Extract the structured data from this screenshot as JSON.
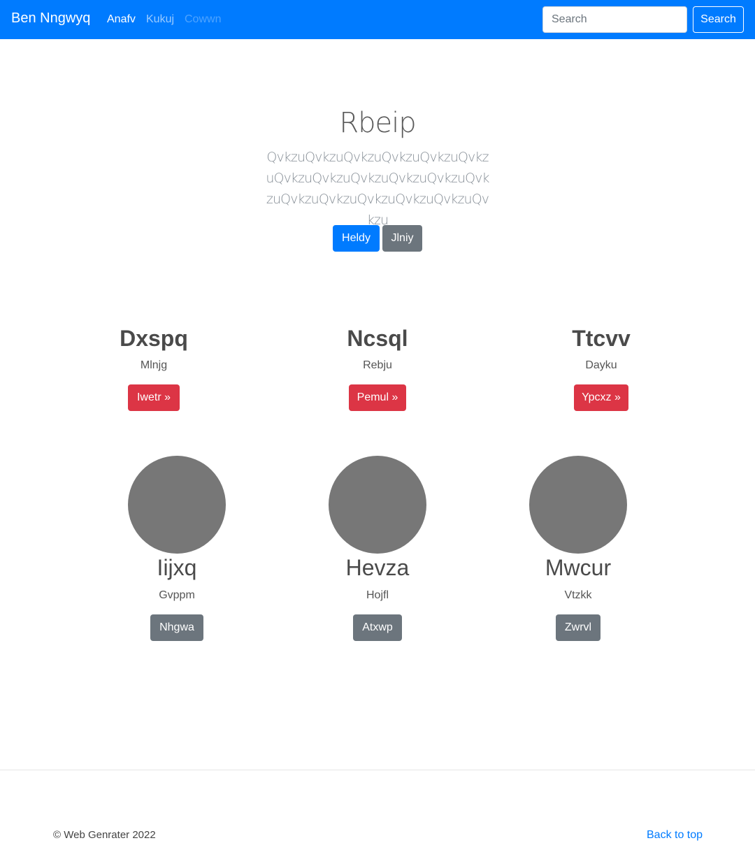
{
  "navbar": {
    "brand": "Ben Nngwyq",
    "links": [
      "Anafv",
      "Kukuj",
      "Cowwn"
    ],
    "search_placeholder": "Search",
    "search_button": "Search"
  },
  "hero": {
    "title": "Rbeip",
    "lead": "QvkzuQvkzuQvkzuQvkzuQvkzuQvkzuQvkzuQvkzuQvkzuQvkzuQvkzuQvkzuQvkzuQvkzuQvkzuQvkzuQvkzuQvkzu",
    "primary_button": "Heldy",
    "secondary_button": "Jlniy"
  },
  "features": [
    {
      "title": "Dxspq",
      "subtitle": "Mlnjg",
      "button": "Iwetr »"
    },
    {
      "title": "Ncsql",
      "subtitle": "Rebju",
      "button": "Pemul »"
    },
    {
      "title": "Ttcvv",
      "subtitle": "Dayku",
      "button": "Ypcxz »"
    }
  ],
  "people": [
    {
      "name": "Iijxq",
      "subtitle": "Gvppm",
      "button": "Nhgwa"
    },
    {
      "name": "Hevza",
      "subtitle": "Hojfl",
      "button": "Atxwp"
    },
    {
      "name": "Mwcur",
      "subtitle": "Vtzkk",
      "button": "Zwrvl"
    }
  ],
  "footer": {
    "copyright": "© Web Genrater 2022",
    "back_to_top": "Back to top"
  },
  "colors": {
    "primary": "#007bff",
    "secondary": "#6c757d",
    "danger": "#dc3545",
    "placeholder_circle": "#777777"
  }
}
